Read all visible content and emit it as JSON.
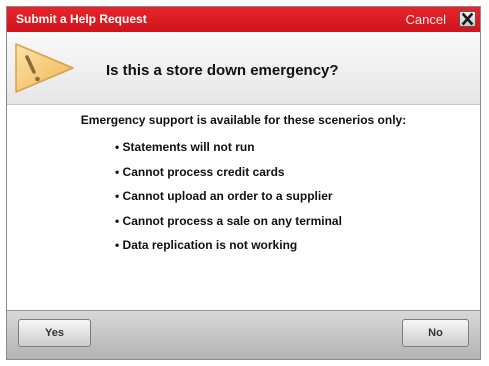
{
  "titlebar": {
    "title": "Submit a Help Request",
    "cancel_label": "Cancel",
    "close_icon": "close-icon"
  },
  "header": {
    "icon": "warning-icon",
    "question": "Is this a store down emergency?"
  },
  "body": {
    "intro": "Emergency support is available for these scenerios only:",
    "bullets": [
      "• Statements will not run",
      "• Cannot process credit cards",
      "• Cannot upload an order to a supplier",
      "• Cannot process a sale on any terminal",
      "• Data replication is not working"
    ]
  },
  "footer": {
    "yes_label": "Yes",
    "no_label": "No"
  },
  "colors": {
    "titlebar": "#d91a22",
    "warning_icon": "#f5c46a"
  }
}
